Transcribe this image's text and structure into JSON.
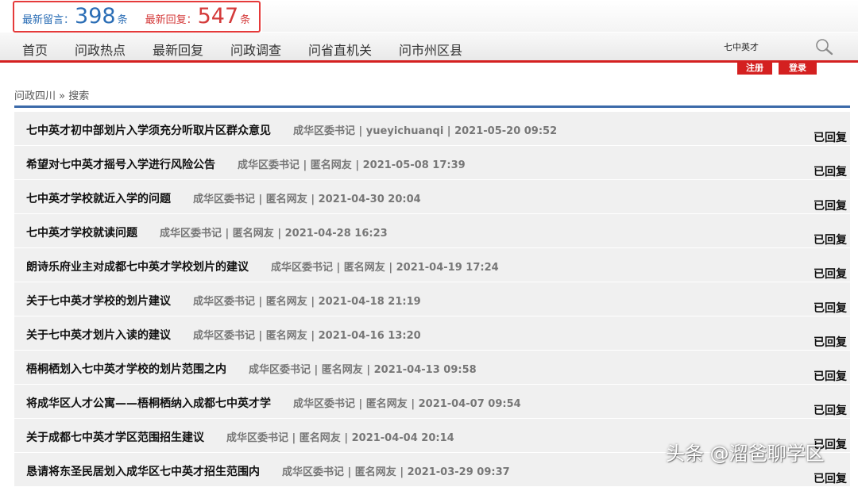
{
  "stats": {
    "latest_messages_label": "最新留言：",
    "latest_messages_count": "398",
    "latest_messages_unit": "条",
    "latest_replies_label": "最新回复：",
    "latest_replies_count": "547",
    "latest_replies_unit": "条"
  },
  "nav": {
    "items": [
      {
        "label": "首页"
      },
      {
        "label": "问政热点"
      },
      {
        "label": "最新回复"
      },
      {
        "label": "问政调查"
      },
      {
        "label": "问省直机关"
      },
      {
        "label": "问市州区县"
      }
    ]
  },
  "search": {
    "value": "七中英才",
    "icon": "search-icon"
  },
  "auth": {
    "register_label": "注册",
    "login_label": "登录"
  },
  "breadcrumb": {
    "text": "问政四川 » 搜索"
  },
  "colors": {
    "accent_red": "#d42020",
    "link_blue": "#2a6db5",
    "rule_blue": "#3b6aa9"
  },
  "results": [
    {
      "title": "七中英才初中部划片入学须充分听取片区群众意见",
      "meta": "成华区委书记 | yueyichuanqi | 2021-05-20 09:52",
      "status": "已回复"
    },
    {
      "title": "希望对七中英才摇号入学进行风险公告",
      "meta": "成华区委书记 | 匿名网友 | 2021-05-08 17:39",
      "status": "已回复"
    },
    {
      "title": "七中英才学校就近入学的问题",
      "meta": "成华区委书记 | 匿名网友 | 2021-04-30 20:04",
      "status": "已回复"
    },
    {
      "title": "七中英才学校就读问题",
      "meta": "成华区委书记 | 匿名网友 | 2021-04-28 16:23",
      "status": "已回复"
    },
    {
      "title": "朗诗乐府业主对成都七中英才学校划片的建议",
      "meta": "成华区委书记 | 匿名网友 | 2021-04-19 17:24",
      "status": "已回复"
    },
    {
      "title": "关于七中英才学校的划片建议",
      "meta": "成华区委书记 | 匿名网友 | 2021-04-18 21:19",
      "status": "已回复"
    },
    {
      "title": "关于七中英才划片入读的建议",
      "meta": "成华区委书记 | 匿名网友 | 2021-04-16 13:20",
      "status": "已回复"
    },
    {
      "title": "梧桐栖划入七中英才学校的划片范围之内",
      "meta": "成华区委书记 | 匿名网友 | 2021-04-13 09:58",
      "status": "已回复"
    },
    {
      "title": "将成华区人才公寓——梧桐栖纳入成都七中英才学",
      "meta": "成华区委书记 | 匿名网友 | 2021-04-07 09:54",
      "status": "已回复"
    },
    {
      "title": "关于成都七中英才学区范围招生建议",
      "meta": "成华区委书记 | 匿名网友 | 2021-04-04 20:14",
      "status": "已回复"
    },
    {
      "title": "恳请将东圣民居划入成华区七中英才招生范围内",
      "meta": "成华区委书记 | 匿名网友 | 2021-03-29 09:37",
      "status": "已回复"
    }
  ],
  "watermark": {
    "text": "头条 @溜爸聊学区"
  }
}
